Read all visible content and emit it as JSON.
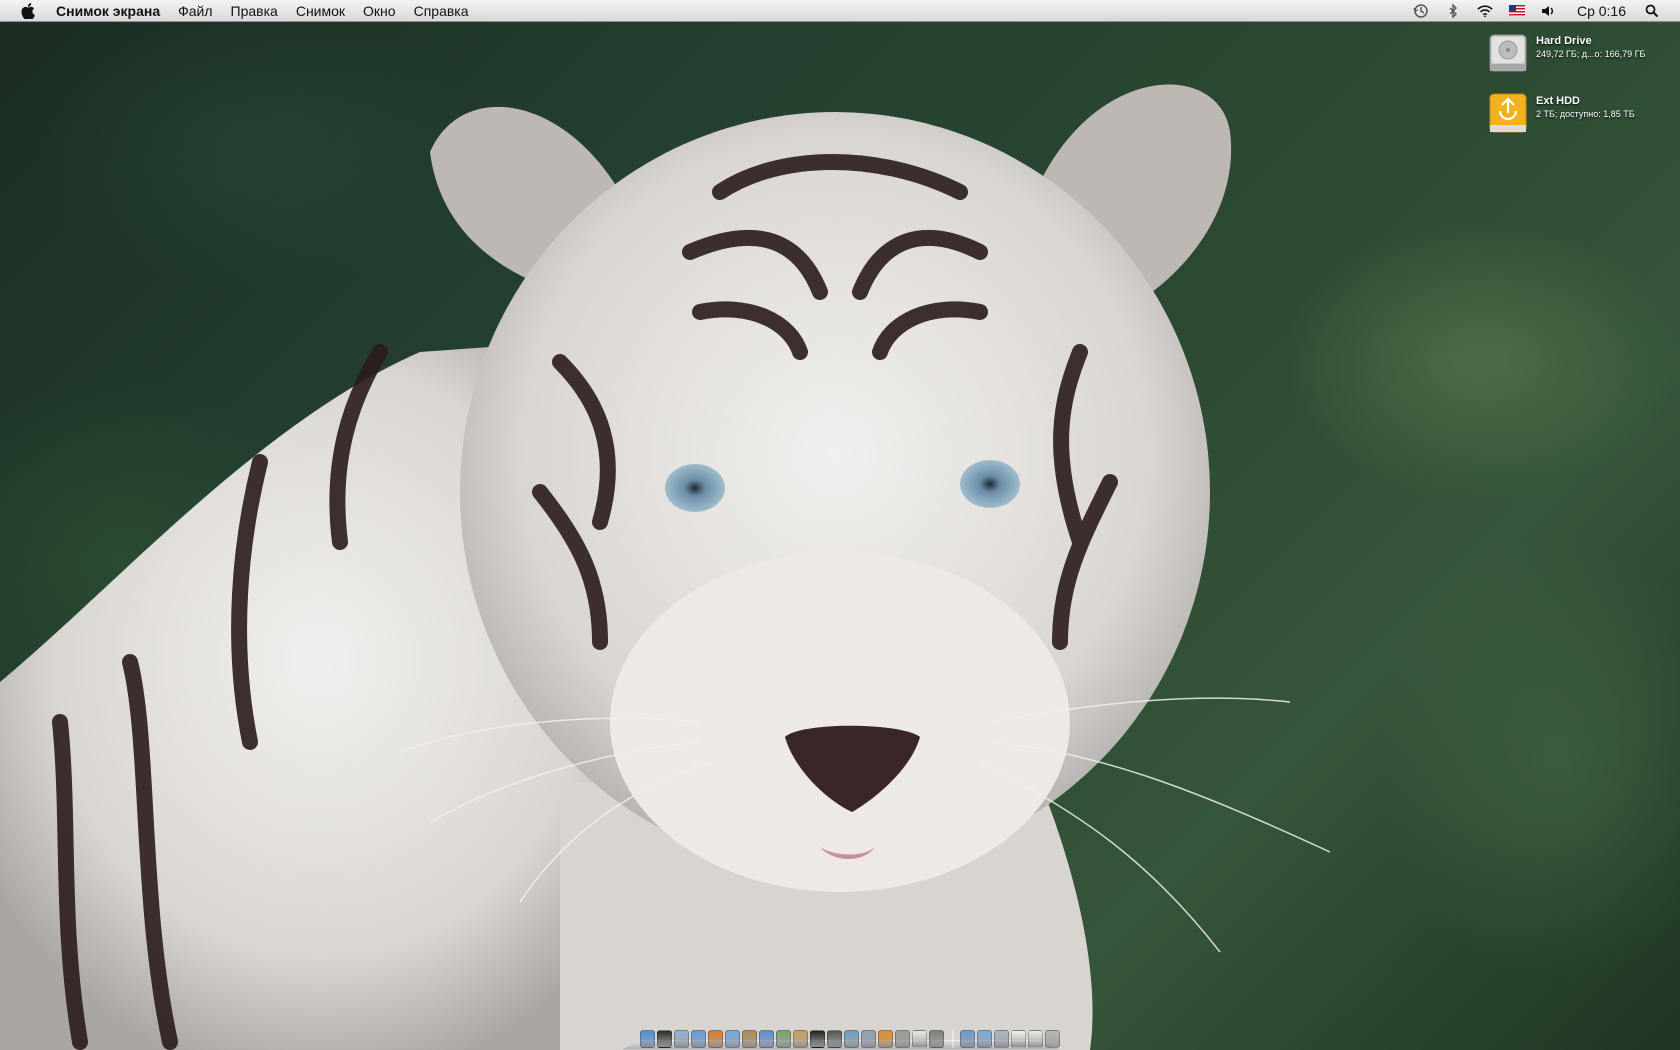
{
  "menubar": {
    "apple_icon": "apple-logo-icon",
    "app_name": "Снимок экрана",
    "menus": [
      "Файл",
      "Правка",
      "Снимок",
      "Окно",
      "Справка"
    ],
    "status_icons": [
      "time-machine-icon",
      "bluetooth-icon",
      "wifi-icon",
      "us-flag-input-icon",
      "volume-icon"
    ],
    "clock": "Ср 0:16",
    "spotlight_icon": "spotlight-search-icon"
  },
  "desktop": {
    "wallpaper": "white-tiger-photo",
    "drives": [
      {
        "name": "Hard Drive",
        "info": "249,72 ГБ; д...о: 166,79 ГБ",
        "icon": "internal-hard-drive-icon"
      },
      {
        "name": "Ext HDD",
        "info": "2 ТБ; доступно: 1,85 ТБ",
        "icon": "external-firewire-drive-icon"
      }
    ]
  },
  "dock": {
    "apps": [
      {
        "icon": "finder-icon",
        "color": "#4a8fe0"
      },
      {
        "icon": "dashboard-icon",
        "color": "#2d2d2d"
      },
      {
        "icon": "mail-icon",
        "color": "#8fb3d6"
      },
      {
        "icon": "safari-icon",
        "color": "#5aa0e6"
      },
      {
        "icon": "firefox-icon",
        "color": "#e07a25"
      },
      {
        "icon": "ichat-icon",
        "color": "#6fa8e8"
      },
      {
        "icon": "address-book-icon",
        "color": "#b08a4a"
      },
      {
        "icon": "itunes-icon",
        "color": "#5b8fd8"
      },
      {
        "icon": "iphoto-icon",
        "color": "#7aa36a"
      },
      {
        "icon": "garageband-icon",
        "color": "#c9a25a"
      },
      {
        "icon": "terminal-icon",
        "color": "#222222"
      },
      {
        "icon": "chess-icon",
        "color": "#555555"
      },
      {
        "icon": "preview-icon",
        "color": "#6aa0c8"
      },
      {
        "icon": "xcode-icon",
        "color": "#8fa0b8"
      },
      {
        "icon": "vlc-icon",
        "color": "#f08a1a"
      },
      {
        "icon": "utility-icon",
        "color": "#9a9a9a"
      },
      {
        "icon": "textedit-icon",
        "color": "#e8e8e8"
      },
      {
        "icon": "system-preferences-icon",
        "color": "#7f7f7f"
      }
    ],
    "others": [
      {
        "icon": "applications-folder-icon",
        "color": "#6a9ad6"
      },
      {
        "icon": "documents-folder-icon",
        "color": "#7aaae0"
      },
      {
        "icon": "downloads-stack-icon",
        "color": "#a8b8c8"
      },
      {
        "icon": "document-stack-icon",
        "color": "#f0f0f0"
      },
      {
        "icon": "calendar-stack-icon",
        "color": "#e8e8e8"
      },
      {
        "icon": "trash-icon",
        "color": "#b8b8b8"
      }
    ]
  }
}
